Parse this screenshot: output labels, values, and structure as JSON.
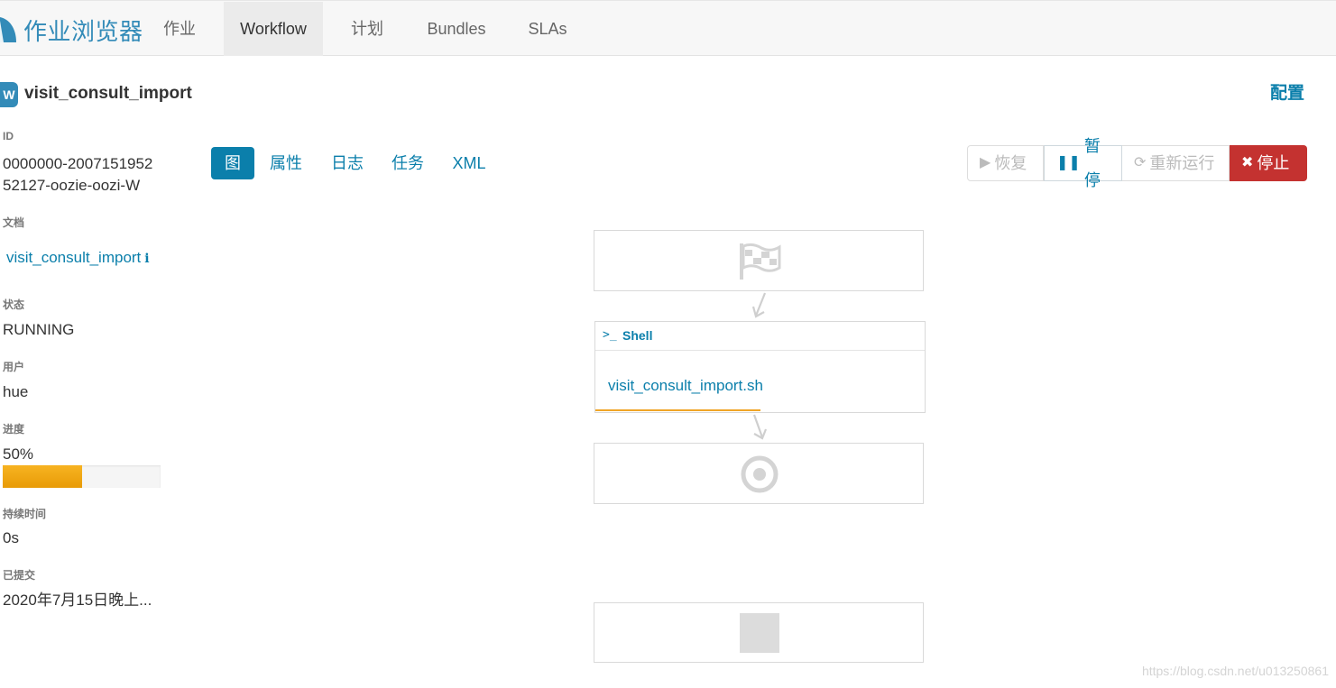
{
  "brand": {
    "title": "作业浏览器",
    "accent": "#338bb8"
  },
  "nav": {
    "tabs": [
      {
        "label": "作业",
        "active": false
      },
      {
        "label": "Workflow",
        "active": true
      },
      {
        "label": "计划",
        "active": false
      },
      {
        "label": "Bundles",
        "active": false
      },
      {
        "label": "SLAs",
        "active": false
      }
    ]
  },
  "workflow": {
    "icon_letter": "W",
    "name": "visit_consult_import",
    "config_label": "配置"
  },
  "details": {
    "id_label": "ID",
    "id_line1": "0000000-2007151952",
    "id_line2": "52127-oozie-oozi-W",
    "doc_label": "文档",
    "doc_link": "visit_consult_import",
    "doc_info_icon": "info-icon",
    "status_label": "状态",
    "status_value": "RUNNING",
    "user_label": "用户",
    "user_value": "hue",
    "progress_label": "进度",
    "progress_text": "50%",
    "progress_value": 0.5,
    "duration_label": "持续时间",
    "duration_value": "0s",
    "submitted_label": "已提交",
    "submitted_value": "2020年7月15日晚上..."
  },
  "subtabs": [
    {
      "label": "图",
      "active": true
    },
    {
      "label": "属性",
      "active": false
    },
    {
      "label": "日志",
      "active": false
    },
    {
      "label": "任务",
      "active": false
    },
    {
      "label": "XML",
      "active": false
    }
  ],
  "actions": {
    "resume": {
      "label": "恢复",
      "icon": "play-icon",
      "enabled": false
    },
    "suspend": {
      "label": "暂停",
      "icon": "pause-icon",
      "enabled": true
    },
    "rerun": {
      "label": "重新运行",
      "icon": "refresh-icon",
      "enabled": false
    },
    "kill": {
      "label": "停止",
      "icon": "x-icon",
      "enabled": true,
      "color": "#c43230"
    }
  },
  "graph": {
    "start_icon": "flag-icon",
    "shell_node": {
      "prompt": ">_",
      "type_label": "Shell",
      "file": "visit_consult_import.sh",
      "progress": 0.5
    },
    "end_icon": "target-icon",
    "kill_icon": "square-icon"
  },
  "watermark": "https://blog.csdn.net/u013250861"
}
